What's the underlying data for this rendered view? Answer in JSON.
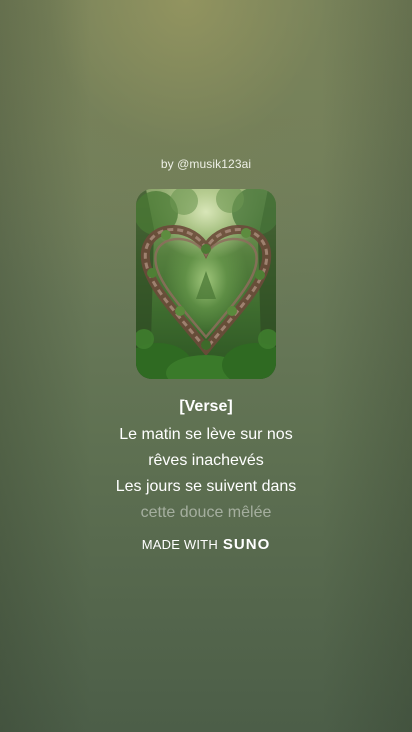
{
  "author": "by @musik123ai",
  "cover": {
    "icon": "heart-vine-artwork"
  },
  "lyrics": {
    "section_tag": "[Verse]",
    "lines": [
      "Le matin se lève sur nos",
      "rêves inachevés",
      "Les jours se suivent dans",
      "cette douce mêlée"
    ]
  },
  "footer": {
    "made_with": "MADE WITH",
    "brand": "SUNO"
  }
}
